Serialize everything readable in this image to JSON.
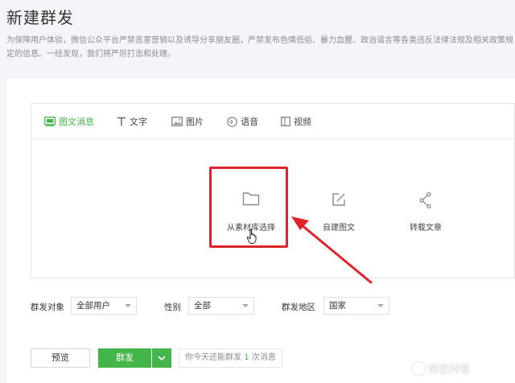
{
  "page": {
    "title": "新建群发",
    "notice": "为保障用户体验，微信公众平台严禁恶意营销以及诱导分享朋友圈，严禁发布色情低俗、暴力血腥、政治谣言等各类违反法律法规及相关政策规定的信息。一经发现，我们将严厉打击和处理。"
  },
  "editor": {
    "tabs": [
      {
        "label": "图文消息",
        "icon": "image-text-icon",
        "active": true
      },
      {
        "label": "文字",
        "icon": "text-icon"
      },
      {
        "label": "图片",
        "icon": "picture-icon"
      },
      {
        "label": "语音",
        "icon": "voice-icon"
      },
      {
        "label": "视频",
        "icon": "video-icon"
      }
    ],
    "choices": [
      {
        "label": "从素材库选择",
        "icon": "folder-icon"
      },
      {
        "label": "自建图文",
        "icon": "edit-icon"
      },
      {
        "label": "转载文章",
        "icon": "share-icon"
      }
    ]
  },
  "filters": {
    "target_label": "群发对象",
    "target_value": "全部用户",
    "gender_label": "性别",
    "gender_value": "全部",
    "region_label": "群发地区",
    "region_value": "国家"
  },
  "actions": {
    "preview_label": "预览",
    "send_label": "群发",
    "quota_prefix": "你今天还能群发",
    "quota_count": "1",
    "quota_suffix": "次消息"
  },
  "watermark": {
    "text": "悟空问答"
  },
  "colors": {
    "accent": "#44b549",
    "highlight": "#e0222b"
  }
}
